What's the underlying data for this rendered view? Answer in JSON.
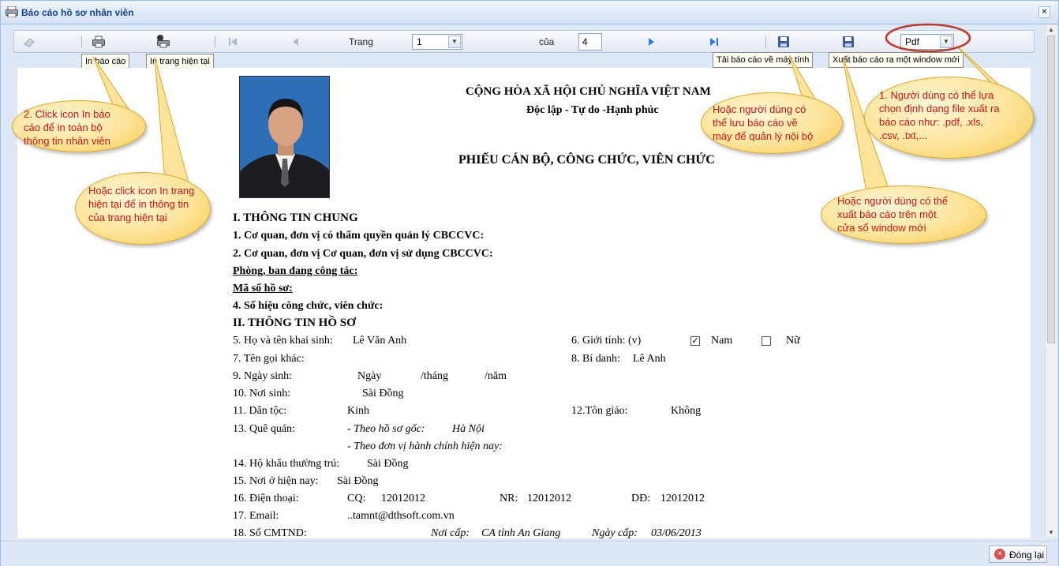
{
  "window": {
    "title": "Báo cáo hồ sơ nhân viên",
    "close_glyph": "×"
  },
  "toolbar": {
    "page_label": "Trang",
    "page_value": "1",
    "of_label": "của",
    "total_pages": "4",
    "format_value": "Pdf",
    "print_all_tooltip": "In báo cáo",
    "print_page_tooltip": "In trang hiện tại",
    "download_tooltip": "Tải báo cáo về máy tính",
    "export_window_tooltip": "Xuất báo cáo ra một window mới"
  },
  "callouts": {
    "c1": "2. Click icon In báo\ncáo để in toàn bộ\nthông tin nhân viên",
    "c2": "Hoặc click icon In trang\nhiện tại để in thông tin\ncủa trang hiện tại",
    "c3": "Hoặc người dùng có\nthể lưu báo cáo về\nmáy để quản lý nội bộ",
    "c4": "Hoặc người dùng có thể\nxuất báo cáo trên một\ncửa sổ window mới",
    "c5": "1. Người dùng có thể lựa\nchọn định dạng file xuất ra\nbáo cáo như: .pdf, .xls,\n.csv, .txt,..."
  },
  "report": {
    "country": "CỘNG HÒA XÃ HỘI CHỦ NGHĨA VIỆT NAM",
    "motto": "Độc lập - Tự do -Hạnh phúc",
    "form_title": "PHIẾU CÁN BỘ, CÔNG CHỨC, VIÊN CHỨC",
    "section1": "I. THÔNG TIN CHUNG",
    "item1": "1.  Cơ quan, đơn vị có thẩm quyền quản lý CBCCVC:",
    "item2": "2.  Cơ quan, đơn vị Cơ quan, đơn vị sử dụng CBCCVC:",
    "department": "Phòng, ban đang công tác:",
    "file_code": "Mã số hồ sơ:",
    "item4": "4.  Số hiệu công chức, viên chức:",
    "section2": "II. THÔNG TIN HỒ SƠ",
    "f5_label": "5. Họ và tên khai sinh:",
    "f5_value": "Lê Văn Anh",
    "f6_label": "6. Giới tính: (v)",
    "male_label": "Nam",
    "female_label": "Nữ",
    "check_mark": "✓",
    "f7_label": "7. Tên gọi khác:",
    "f8_label": "8. Bí danh:",
    "f8_value": "Lê Anh",
    "f9_label": "9. Ngày sinh:",
    "f9_day": "Ngày",
    "f9_month": "/tháng",
    "f9_year": "/năm",
    "f10_label": "10. Nơi sinh:",
    "f10_value": "Sài Đồng",
    "f11_label": "11. Dân tộc:",
    "f11_value": "Kinh",
    "f12_label": "12.Tôn giáo:",
    "f12_value": "Không",
    "f13_label": "13. Quê quán:",
    "f13_orig_label": "- Theo hồ sơ gốc:",
    "f13_orig_value": "Hà Nội",
    "f13_admin_label": "- Theo đơn vị hành chính hiện nay:",
    "f14_label": "14. Hộ khẩu thường trú:",
    "f14_value": "Sài Đồng",
    "f15_label": "15. Nơi ở hiện nay:",
    "f15_value": "Sài Đồng",
    "f16_label": "16. Điện thoại:",
    "f16_cq_label": "CQ:",
    "f16_cq": "12012012",
    "f16_nr_label": "NR:",
    "f16_nr": "12012012",
    "f16_dd_label": "DĐ:",
    "f16_dd": "12012012",
    "f17_label": "17. Email:",
    "f17_value": "..tamnt@dthsoft.com.vn",
    "f18_label": "18. Số CMTND:",
    "f18_place_label": "Nơi cấp:",
    "f18_place": "CA tỉnh An Giang",
    "f18_date_label": "Ngày cấp:",
    "f18_date": "03/06/2013"
  },
  "footer": {
    "close_label": "Đóng lại",
    "close_icon_glyph": "×"
  },
  "colors": {
    "callout_text": "#c41616",
    "callout_fill": "#fde49a",
    "title_text": "#15428b",
    "highlight_circle": "#c0392b"
  }
}
